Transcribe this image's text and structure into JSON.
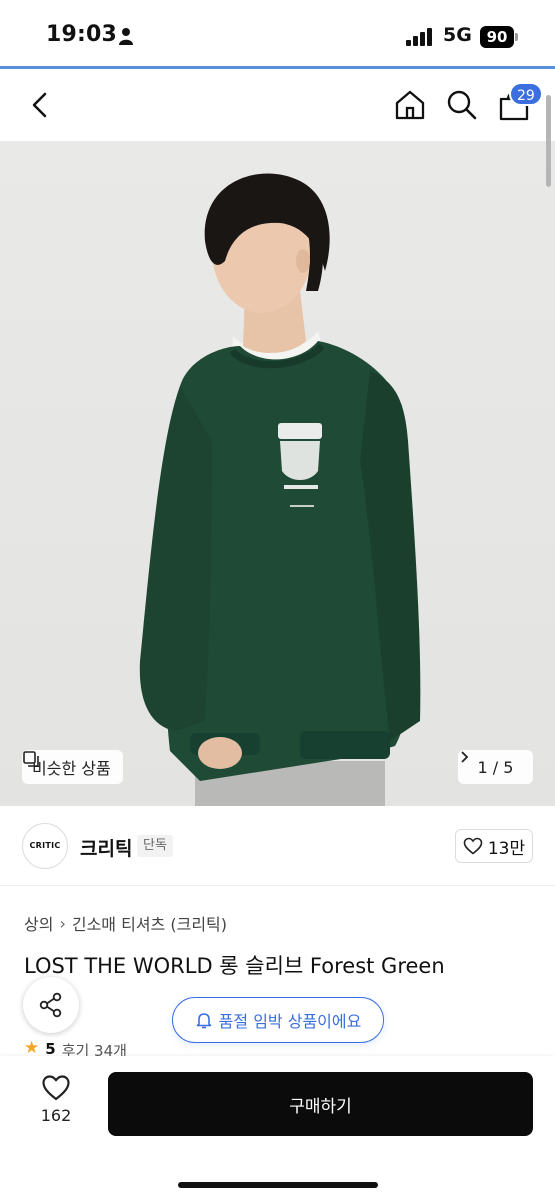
{
  "status_bar": {
    "time": "19:03",
    "network": "5G",
    "battery": "90"
  },
  "nav": {
    "cart_count": "29"
  },
  "hero": {
    "similar_label": "비슷한 상품",
    "page_indicator": "1 / 5"
  },
  "brand": {
    "logo_text": "CRITIC",
    "name": "크리틱",
    "tag": "단독",
    "likes": "13만"
  },
  "product": {
    "breadcrumb": [
      "상의",
      "긴소매 티셔츠 (크리틱)"
    ],
    "title": "LOST THE WORLD 롱 슬리브 Forest Green",
    "stock_notice": "품절 임박 상품이에요",
    "rating_score": "5",
    "review_label": "후기 34개"
  },
  "bottom_bar": {
    "wish_count": "162",
    "buy_label": "구매하기"
  },
  "colors": {
    "accent": "#3b6fe0",
    "shirt": "#1f4a35",
    "buy_button": "#0b0b0b"
  }
}
